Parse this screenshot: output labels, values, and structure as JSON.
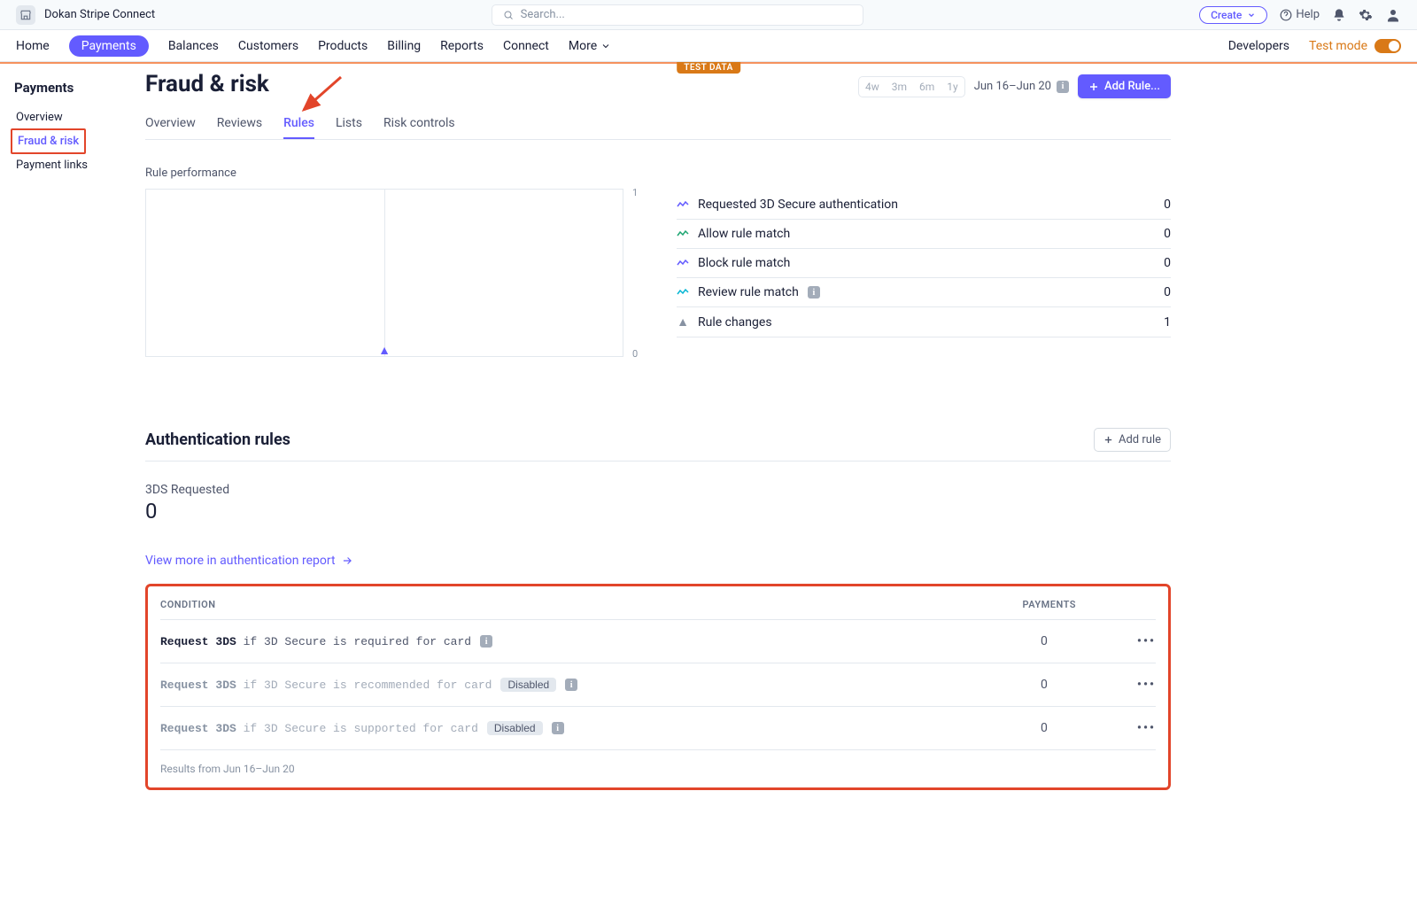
{
  "brand": "Dokan Stripe Connect",
  "search": {
    "placeholder": "Search..."
  },
  "top": {
    "create": "Create",
    "help": "Help"
  },
  "nav": {
    "items": [
      "Home",
      "Payments",
      "Balances",
      "Customers",
      "Products",
      "Billing",
      "Reports",
      "Connect",
      "More"
    ],
    "developers": "Developers",
    "test_mode": "Test mode"
  },
  "test_badge": "TEST DATA",
  "sidebar": {
    "title": "Payments",
    "items": [
      "Overview",
      "Fraud & risk",
      "Payment links"
    ]
  },
  "page": {
    "title": "Fraud & risk",
    "periods": [
      "4w",
      "3m",
      "6m",
      "1y"
    ],
    "date_range": "Jun 16–Jun 20",
    "add_rule_btn": "Add Rule..."
  },
  "tabs": [
    "Overview",
    "Reviews",
    "Rules",
    "Lists",
    "Risk controls"
  ],
  "perf": {
    "label": "Rule performance",
    "y_top": "1",
    "y_bot": "0"
  },
  "legend": [
    {
      "label": "Requested 3D Secure authentication",
      "value": "0",
      "color": "#635bff"
    },
    {
      "label": "Allow rule match",
      "value": "0",
      "color": "#1ea672"
    },
    {
      "label": "Block rule match",
      "value": "0",
      "color": "#635bff"
    },
    {
      "label": "Review rule match",
      "value": "0",
      "color": "#06b6d4",
      "info": true
    },
    {
      "label": "Rule changes",
      "value": "1",
      "color": "#8792a2",
      "triangle": true
    }
  ],
  "auth": {
    "title": "Authentication rules",
    "add_rule": "Add rule",
    "stat_label": "3DS Requested",
    "stat_value": "0",
    "view_more": "View more in authentication report"
  },
  "table": {
    "col_condition": "CONDITION",
    "col_payments": "PAYMENTS",
    "rows": [
      {
        "action": "Request 3DS",
        "cond": "if 3D Secure is required for card",
        "payments": "0",
        "disabled": false,
        "info": true
      },
      {
        "action": "Request 3DS",
        "cond": "if 3D Secure is recommended for card",
        "payments": "0",
        "disabled": true,
        "info": true
      },
      {
        "action": "Request 3DS",
        "cond": "if 3D Secure is supported for card",
        "payments": "0",
        "disabled": true,
        "info": true
      }
    ],
    "disabled_label": "Disabled",
    "results_note": "Results from Jun 16–Jun 20"
  },
  "chart_data": {
    "type": "line",
    "title": "Rule performance",
    "xlabel": "",
    "ylabel": "",
    "ylim": [
      0,
      1
    ],
    "series": [
      {
        "name": "Requested 3D Secure authentication",
        "values": []
      },
      {
        "name": "Allow rule match",
        "values": []
      },
      {
        "name": "Block rule match",
        "values": []
      },
      {
        "name": "Review rule match",
        "values": []
      }
    ],
    "rule_change_markers": 1
  }
}
